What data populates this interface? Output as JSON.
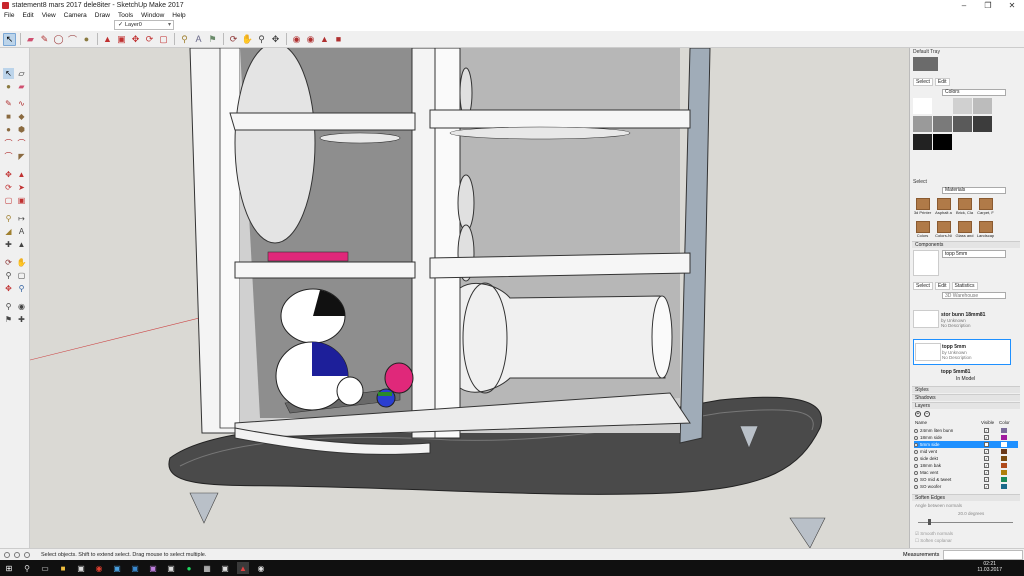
{
  "window": {
    "title": "statement8 mars 2017 dele8iter - SketchUp Make 2017"
  },
  "menu": [
    "File",
    "Edit",
    "View",
    "Camera",
    "Draw",
    "Tools",
    "Window",
    "Help"
  ],
  "layer_dropdown": {
    "value": "Layer0"
  },
  "tray": {
    "default_tray": "Default Tray",
    "colors_select_label": "Select",
    "colors_edit_label": "Edit",
    "colors_dropdown": "Colors",
    "materials_select_label": "Select",
    "materials_dropdown": "Materials",
    "materials": [
      "3d Printer",
      "Asphalt a",
      "Brick, Cla",
      "Carpet, F",
      "Colors",
      "Colors-Ni",
      "Glass and",
      "Landscap"
    ],
    "components_header": "Components",
    "component_name": "topp 5mm",
    "comp_tabs": [
      "Select",
      "Edit",
      "Statistics"
    ],
    "search_placeholder": "3D Warehouse",
    "component_items": [
      {
        "name": "stor bunn 18mm81",
        "by": "by Unknown",
        "desc": "No Description"
      },
      {
        "name": "topp 5mm",
        "by": "by Unknown",
        "desc": "No Description"
      },
      {
        "name": "topp 5mm81",
        "by": "",
        "desc": ""
      }
    ],
    "in_model": "In Model",
    "styles_header": "Styles",
    "shadows_header": "Shadows",
    "layers_header": "Layers",
    "layers_cols": [
      "Name",
      "Visible",
      "Color"
    ],
    "layers": [
      {
        "name": "24mm liten bunn",
        "color": "#7a6a9a"
      },
      {
        "name": "18mm side",
        "color": "#a01aa0"
      },
      {
        "name": "5mm side",
        "color": "#ffffff",
        "active": true
      },
      {
        "name": "mid vent",
        "color": "#6a3a1a"
      },
      {
        "name": "side dekt",
        "color": "#7a4a10"
      },
      {
        "name": "18mm bak",
        "color": "#b04a1a"
      },
      {
        "name": "Mac vent",
        "color": "#b0800a"
      },
      {
        "name": "SO mid & tweet",
        "color": "#1a8a5a"
      },
      {
        "name": "SO woofer",
        "color": "#1a6a8a"
      }
    ],
    "soften_header": "Soften Edges",
    "soften_label": "Angle between normals",
    "soften_value": "20.0  degrees",
    "smooth_normals": "Smooth normals",
    "soften_coplanar": "Soften coplanar"
  },
  "colors": {
    "accent": "#1e90ff",
    "panel": "#f0f0f0",
    "viewport": "#dad9d4"
  },
  "status": {
    "text": "Select objects. Shift to extend select. Drag mouse to select multiple.",
    "measurements": "Measurements"
  },
  "clock": {
    "time": "02:21",
    "date": "11.03.2017"
  }
}
